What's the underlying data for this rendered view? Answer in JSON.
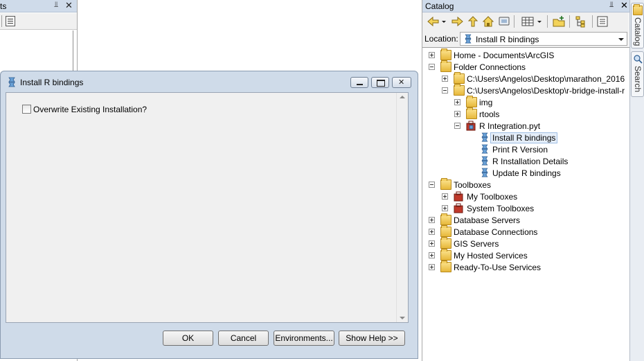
{
  "left_pane": {
    "title_fragment": "ts",
    "pin_glyph": "⫫",
    "close_glyph": "✕"
  },
  "dialog": {
    "title": "Install R bindings",
    "checkbox_label": "Overwrite Existing Installation?",
    "buttons": {
      "ok": "OK",
      "cancel": "Cancel",
      "environments": "Environments...",
      "show_help": "Show Help >>"
    }
  },
  "catalog": {
    "title": "Catalog",
    "pin_glyph": "⫫",
    "close_glyph": "✕",
    "location_label": "Location:",
    "location_value": "Install R bindings",
    "tree": {
      "home": "Home - Documents\\ArcGIS",
      "folder_connections": "Folder Connections",
      "marathon": "C:\\Users\\Angelos\\Desktop\\marathon_2016",
      "rbridge": "C:\\Users\\Angelos\\Desktop\\r-bridge-install-r",
      "img": "img",
      "rtools": "rtools",
      "r_integration": "R Integration.pyt",
      "install_r": "Install R bindings",
      "print_r": "Print R Version",
      "r_install_details": "R Installation Details",
      "update_r": "Update R bindings",
      "toolboxes": "Toolboxes",
      "my_toolboxes": "My Toolboxes",
      "system_toolboxes": "System Toolboxes",
      "database_servers": "Database Servers",
      "database_connections": "Database Connections",
      "gis_servers": "GIS Servers",
      "my_hosted": "My Hosted Services",
      "ready_to_use": "Ready-To-Use Services"
    }
  },
  "side_tabs": {
    "catalog": "Catalog",
    "search": "Search"
  },
  "colors": {
    "titlebar": "#cfdbea",
    "dialog_frame": "#cfdbe9",
    "folder": "#e7b83b",
    "selection": "#e5eef9"
  }
}
